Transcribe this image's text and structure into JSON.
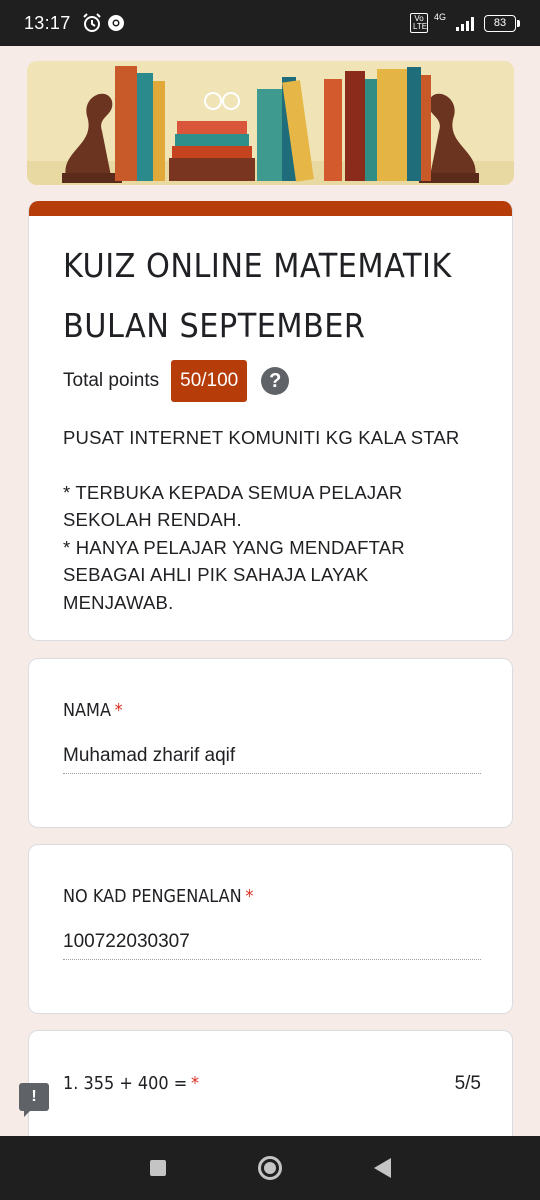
{
  "status_bar": {
    "time": "13:17",
    "volte": "Vo LTE",
    "network": "4G",
    "battery": "83"
  },
  "form": {
    "title": "KUIZ ONLINE MATEMATIK BULAN SEPTEMBER",
    "points_label": "Total points",
    "points_value": "50/100",
    "help_icon": "?",
    "description": {
      "line1": "PUSAT INTERNET KOMUNITI KG KALA STAR",
      "line2": "* TERBUKA KEPADA SEMUA PELAJAR SEKOLAH RENDAH.",
      "line3": "* HANYA PELAJAR YANG MENDAFTAR SEBAGAI AHLI PIK SAHAJA LAYAK MENJAWAB."
    },
    "accent_color": "#b63c0a"
  },
  "questions": [
    {
      "label": "NAMA",
      "required": "*",
      "answer": "Muhamad zharif aqif"
    },
    {
      "label": "NO KAD PENGENALAN",
      "required": "*",
      "answer": "100722030307"
    },
    {
      "label": "1. 355 + 400 =",
      "required": "*",
      "score": "5/5"
    }
  ],
  "icons": {
    "alarm": "alarm-icon",
    "chrome": "chrome-icon",
    "signal": "signal-icon",
    "feedback": "feedback-icon"
  }
}
